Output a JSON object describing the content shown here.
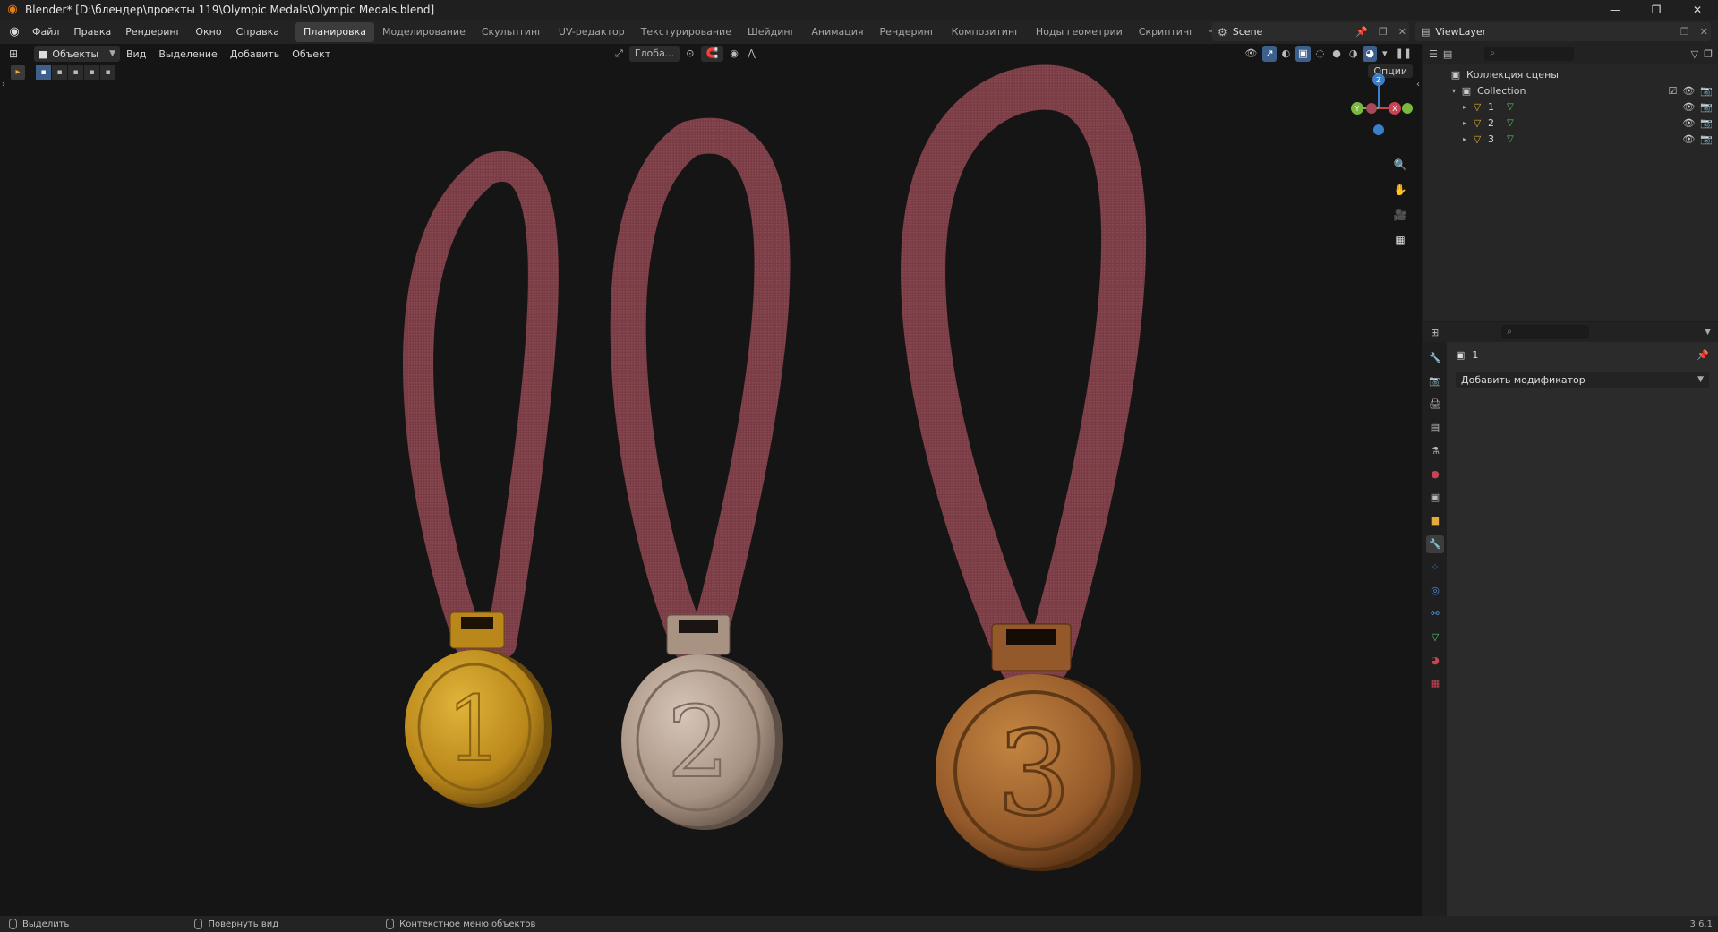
{
  "titlebar": {
    "title": "Blender* [D:\\блендер\\проекты 119\\Olympic Medals\\Olympic Medals.blend]",
    "minimize_icon": "minimize-icon",
    "restore_icon": "restore-icon",
    "close_icon": "close-icon"
  },
  "menu": {
    "items": [
      "Файл",
      "Правка",
      "Рендеринг",
      "Окно",
      "Справка"
    ]
  },
  "workspaces": {
    "tabs": [
      "Планировка",
      "Моделирование",
      "Скульптинг",
      "UV-редактор",
      "Текстурирование",
      "Шейдинг",
      "Анимация",
      "Рендеринг",
      "Композитинг",
      "Ноды геометрии",
      "Скриптинг"
    ],
    "active": "Планировка",
    "add_label": "+"
  },
  "scene": {
    "name": "Scene"
  },
  "view_layer": {
    "name": "ViewLayer"
  },
  "viewport": {
    "mode": "Объекты",
    "menus": [
      "Вид",
      "Выделение",
      "Добавить",
      "Объект"
    ],
    "transform_orientation": "Глоба...",
    "options_label": "Опции",
    "gizmo": {
      "z": "Z",
      "y": "Y",
      "x": "X"
    }
  },
  "scene_content": {
    "medals": [
      {
        "number": "1",
        "material": "gold",
        "color": "#c9961f"
      },
      {
        "number": "2",
        "material": "silver",
        "color": "#b9a596"
      },
      {
        "number": "3",
        "material": "bronze",
        "color": "#a8692c"
      }
    ],
    "ribbon_color": "#7d3f47"
  },
  "outliner": {
    "root_label": "Коллекция сцены",
    "collection": "Collection",
    "objects": [
      "1",
      "2",
      "3"
    ]
  },
  "properties": {
    "active_object": "1",
    "add_modifier_label": "Добавить модификатор"
  },
  "statusbar": {
    "items": [
      "Выделить",
      "Повернуть вид",
      "Контекстное меню объектов"
    ],
    "version": "3.6.1"
  },
  "colors": {
    "accent_blue": "#3d5f8c",
    "blender_orange": "#e87d0d",
    "background": "#151515"
  }
}
